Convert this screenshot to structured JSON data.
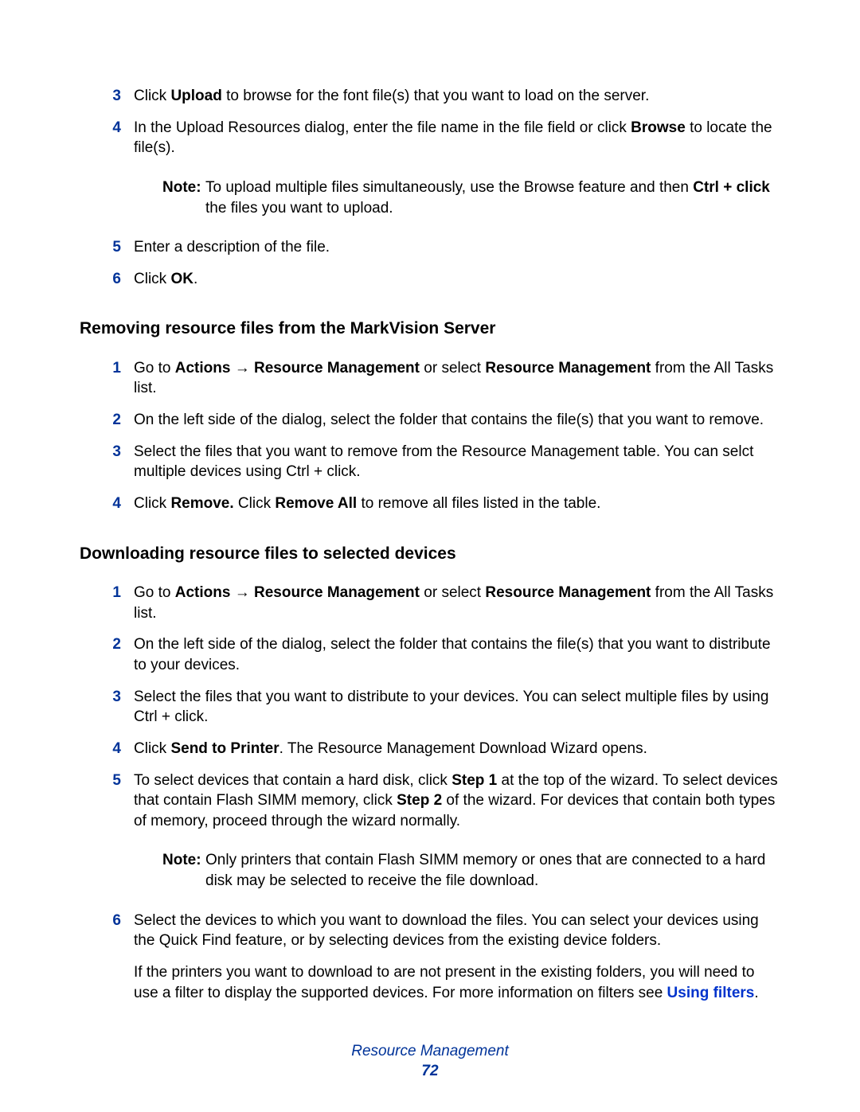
{
  "top_list": {
    "items": [
      {
        "num": "3",
        "parts": [
          {
            "t": "Click "
          },
          {
            "t": "Upload",
            "b": true
          },
          {
            "t": " to browse for the font file(s) that you want to load on the server."
          }
        ]
      },
      {
        "num": "4",
        "parts": [
          {
            "t": "In the Upload Resources dialog, enter the file name in the file field or click "
          },
          {
            "t": "Browse",
            "b": true
          },
          {
            "t": " to locate the file(s)."
          }
        ]
      }
    ],
    "note": {
      "label": "Note:",
      "parts": [
        {
          "t": "To upload multiple files simultaneously, use the Browse feature and then "
        },
        {
          "t": "Ctrl + click",
          "b": true
        },
        {
          "t": " the files you want to upload."
        }
      ]
    },
    "items2": [
      {
        "num": "5",
        "parts": [
          {
            "t": "Enter a description of the file."
          }
        ]
      },
      {
        "num": "6",
        "parts": [
          {
            "t": "Click "
          },
          {
            "t": "OK",
            "b": true
          },
          {
            "t": "."
          }
        ]
      }
    ]
  },
  "section1": {
    "heading": "Removing resource files from the MarkVision Server",
    "items": [
      {
        "num": "1",
        "parts": [
          {
            "t": "Go to "
          },
          {
            "t": "Actions ",
            "b": true
          },
          {
            "t": "→ ",
            "b": true,
            "arrow": true
          },
          {
            "t": "Resource Management",
            "b": true
          },
          {
            "t": " or select "
          },
          {
            "t": "Resource Management",
            "b": true
          },
          {
            "t": " from the All Tasks list."
          }
        ]
      },
      {
        "num": "2",
        "parts": [
          {
            "t": "On the left side of the dialog, select the folder that contains the file(s) that you want to remove."
          }
        ]
      },
      {
        "num": "3",
        "parts": [
          {
            "t": "Select the files that you want to remove from the Resource Management table. You can selct multiple devices using Ctrl + click."
          }
        ]
      },
      {
        "num": "4",
        "parts": [
          {
            "t": "Click "
          },
          {
            "t": "Remove.",
            "b": true
          },
          {
            "t": " Click "
          },
          {
            "t": "Remove All",
            "b": true
          },
          {
            "t": " to remove all files listed in the table."
          }
        ]
      }
    ]
  },
  "section2": {
    "heading": "Downloading resource files to selected devices",
    "items": [
      {
        "num": "1",
        "parts": [
          {
            "t": "Go to "
          },
          {
            "t": "Actions ",
            "b": true
          },
          {
            "t": "→ ",
            "b": true,
            "arrow": true
          },
          {
            "t": "Resource Management",
            "b": true
          },
          {
            "t": " or select "
          },
          {
            "t": "Resource Management",
            "b": true
          },
          {
            "t": " from the All Tasks list."
          }
        ]
      },
      {
        "num": "2",
        "parts": [
          {
            "t": "On the left side of the dialog, select the folder that contains the file(s) that you want to distribute to your devices."
          }
        ]
      },
      {
        "num": "3",
        "parts": [
          {
            "t": "Select the files that you want to distribute to your devices. You can select multiple files by using Ctrl + click."
          }
        ]
      },
      {
        "num": "4",
        "parts": [
          {
            "t": "Click "
          },
          {
            "t": "Send to Printer",
            "b": true
          },
          {
            "t": ". The Resource Management Download Wizard opens."
          }
        ]
      },
      {
        "num": "5",
        "parts": [
          {
            "t": "To select devices that contain a hard disk, click "
          },
          {
            "t": "Step 1",
            "b": true
          },
          {
            "t": " at the top of the wizard. To select devices that contain Flash SIMM memory, click "
          },
          {
            "t": "Step 2",
            "b": true
          },
          {
            "t": " of the wizard. For devices that contain both types of memory, proceed through the wizard normally."
          }
        ]
      }
    ],
    "note": {
      "label": "Note:",
      "parts": [
        {
          "t": "Only printers that contain Flash SIMM memory or ones that are connected to a hard disk may be selected to receive the file download."
        }
      ]
    },
    "items2": [
      {
        "num": "6",
        "parts": [
          {
            "t": "Select the devices to which you want to download the files. You can select your devices using the Quick Find feature, or by selecting devices from the existing device folders."
          }
        ]
      }
    ],
    "extra_para": {
      "parts": [
        {
          "t": "If the printers you want to download to are not present in the existing folders, you will need to use a filter to display the supported devices. For more information on filters see "
        },
        {
          "t": "Using filters",
          "link": true
        },
        {
          "t": "."
        }
      ]
    }
  },
  "footer": {
    "title": "Resource Management",
    "page": "72"
  }
}
